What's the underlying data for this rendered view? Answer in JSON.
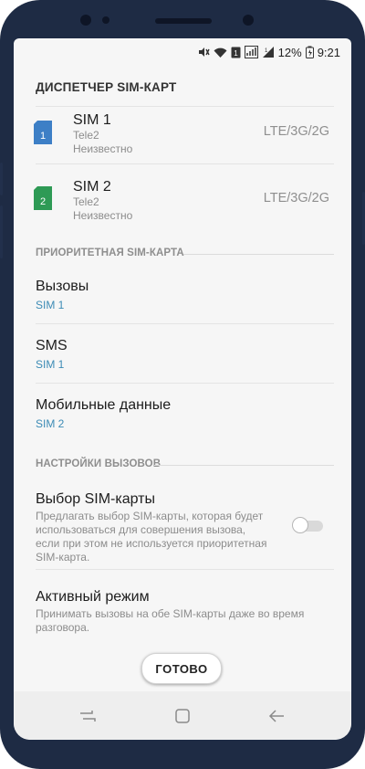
{
  "status": {
    "battery_percent": "12%",
    "time": "9:21"
  },
  "header": {
    "title": "ДИСПЕТЧЕР SIM-КАРТ"
  },
  "sims": [
    {
      "icon_number": "1",
      "name": "SIM 1",
      "operator": "Tele2",
      "state": "Неизвестно",
      "network": "LTE/3G/2G",
      "color": "#3d7fc6"
    },
    {
      "icon_number": "2",
      "name": "SIM 2",
      "operator": "Tele2",
      "state": "Неизвестно",
      "network": "LTE/3G/2G",
      "color": "#2e9a55"
    }
  ],
  "priority": {
    "section_title": "ПРИОРИТЕТНАЯ SIM-КАРТА",
    "calls": {
      "label": "Вызовы",
      "value": "SIM 1"
    },
    "sms": {
      "label": "SMS",
      "value": "SIM 1"
    },
    "data": {
      "label": "Мобильные данные",
      "value": "SIM 2"
    }
  },
  "call_settings": {
    "section_title": "НАСТРОЙКИ ВЫЗОВОВ",
    "sim_choice": {
      "label": "Выбор SIM-карты",
      "desc_lines": [
        "Предлагать выбор SIM-карты, которая будет",
        "использоваться для совершения вызова,",
        "если при этом не используется приоритетная",
        "SIM-карта."
      ],
      "enabled": false
    },
    "active_mode": {
      "label": "Активный режим",
      "desc_lines": [
        "Принимать вызовы на обе SIM-карты даже во время",
        "разговора."
      ]
    }
  },
  "done_button": {
    "label": "ГОТОВО"
  },
  "colors": {
    "accent": "#3c8bb5",
    "frame": "#1e2b44",
    "screen_bg": "#f6f6f6"
  }
}
